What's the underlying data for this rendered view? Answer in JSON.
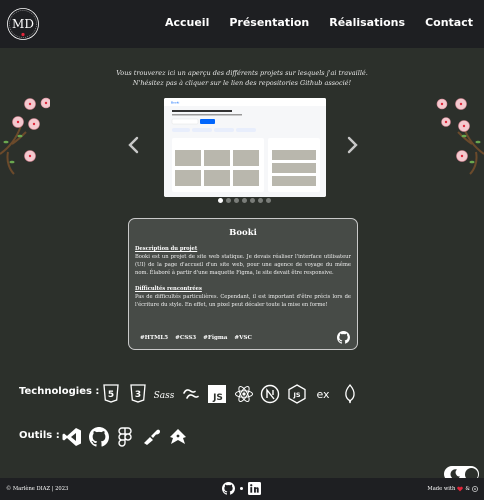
{
  "header": {
    "logo_text": "MD",
    "nav": [
      "Accueil",
      "Présentation",
      "Réalisations",
      "Contact"
    ]
  },
  "intro": {
    "line1": "Vous trouverez ici un aperçu des différents projets sur lesquels j'ai travaillé.",
    "line2": "N'hésitez pas à cliquer sur le lien des repositories Github associé!"
  },
  "carousel": {
    "slide_count": 7,
    "active_slide": 1
  },
  "project": {
    "title": "Booki",
    "description_heading": "Description du projet",
    "description": "Booki est un projet de site web statique. Je devais réaliser l'interface utilisateur (UI) de la page d'accueil d'un site web, pour une agence de voyage du même nom. Élaboré à partir d'une maquette Figma, le site devait être responsive.",
    "difficulties_heading": "Difficultés rencontrées",
    "difficulties": "Pas de difficultés particulières. Cependant, il est important d'être précis lors de l'écriture du style. En effet, un pixel peut décaler toute la mise en forme!",
    "tags": [
      "#HTML5",
      "#CSS3",
      "#Figma",
      "#VSC"
    ]
  },
  "technologies": {
    "label": "Technologies :",
    "icons": [
      "html5-icon",
      "css3-icon",
      "sass-icon",
      "tailwind-icon",
      "javascript-icon",
      "react-icon",
      "nextjs-icon",
      "nodejs-icon",
      "express-icon",
      "mongodb-icon"
    ]
  },
  "tools": {
    "label": "Outils :",
    "icons": [
      "vscode-icon",
      "github-icon",
      "figma-icon",
      "postman-icon",
      "hoppscotch-icon"
    ]
  },
  "footer": {
    "copyright": "© Marlène DIAZ | 2023",
    "made_with": "Made with",
    "ampersand": "&"
  },
  "colors": {
    "background": "#2c302b",
    "header": "#1e1f22",
    "card": "#474b47",
    "heart": "#e0263a"
  }
}
